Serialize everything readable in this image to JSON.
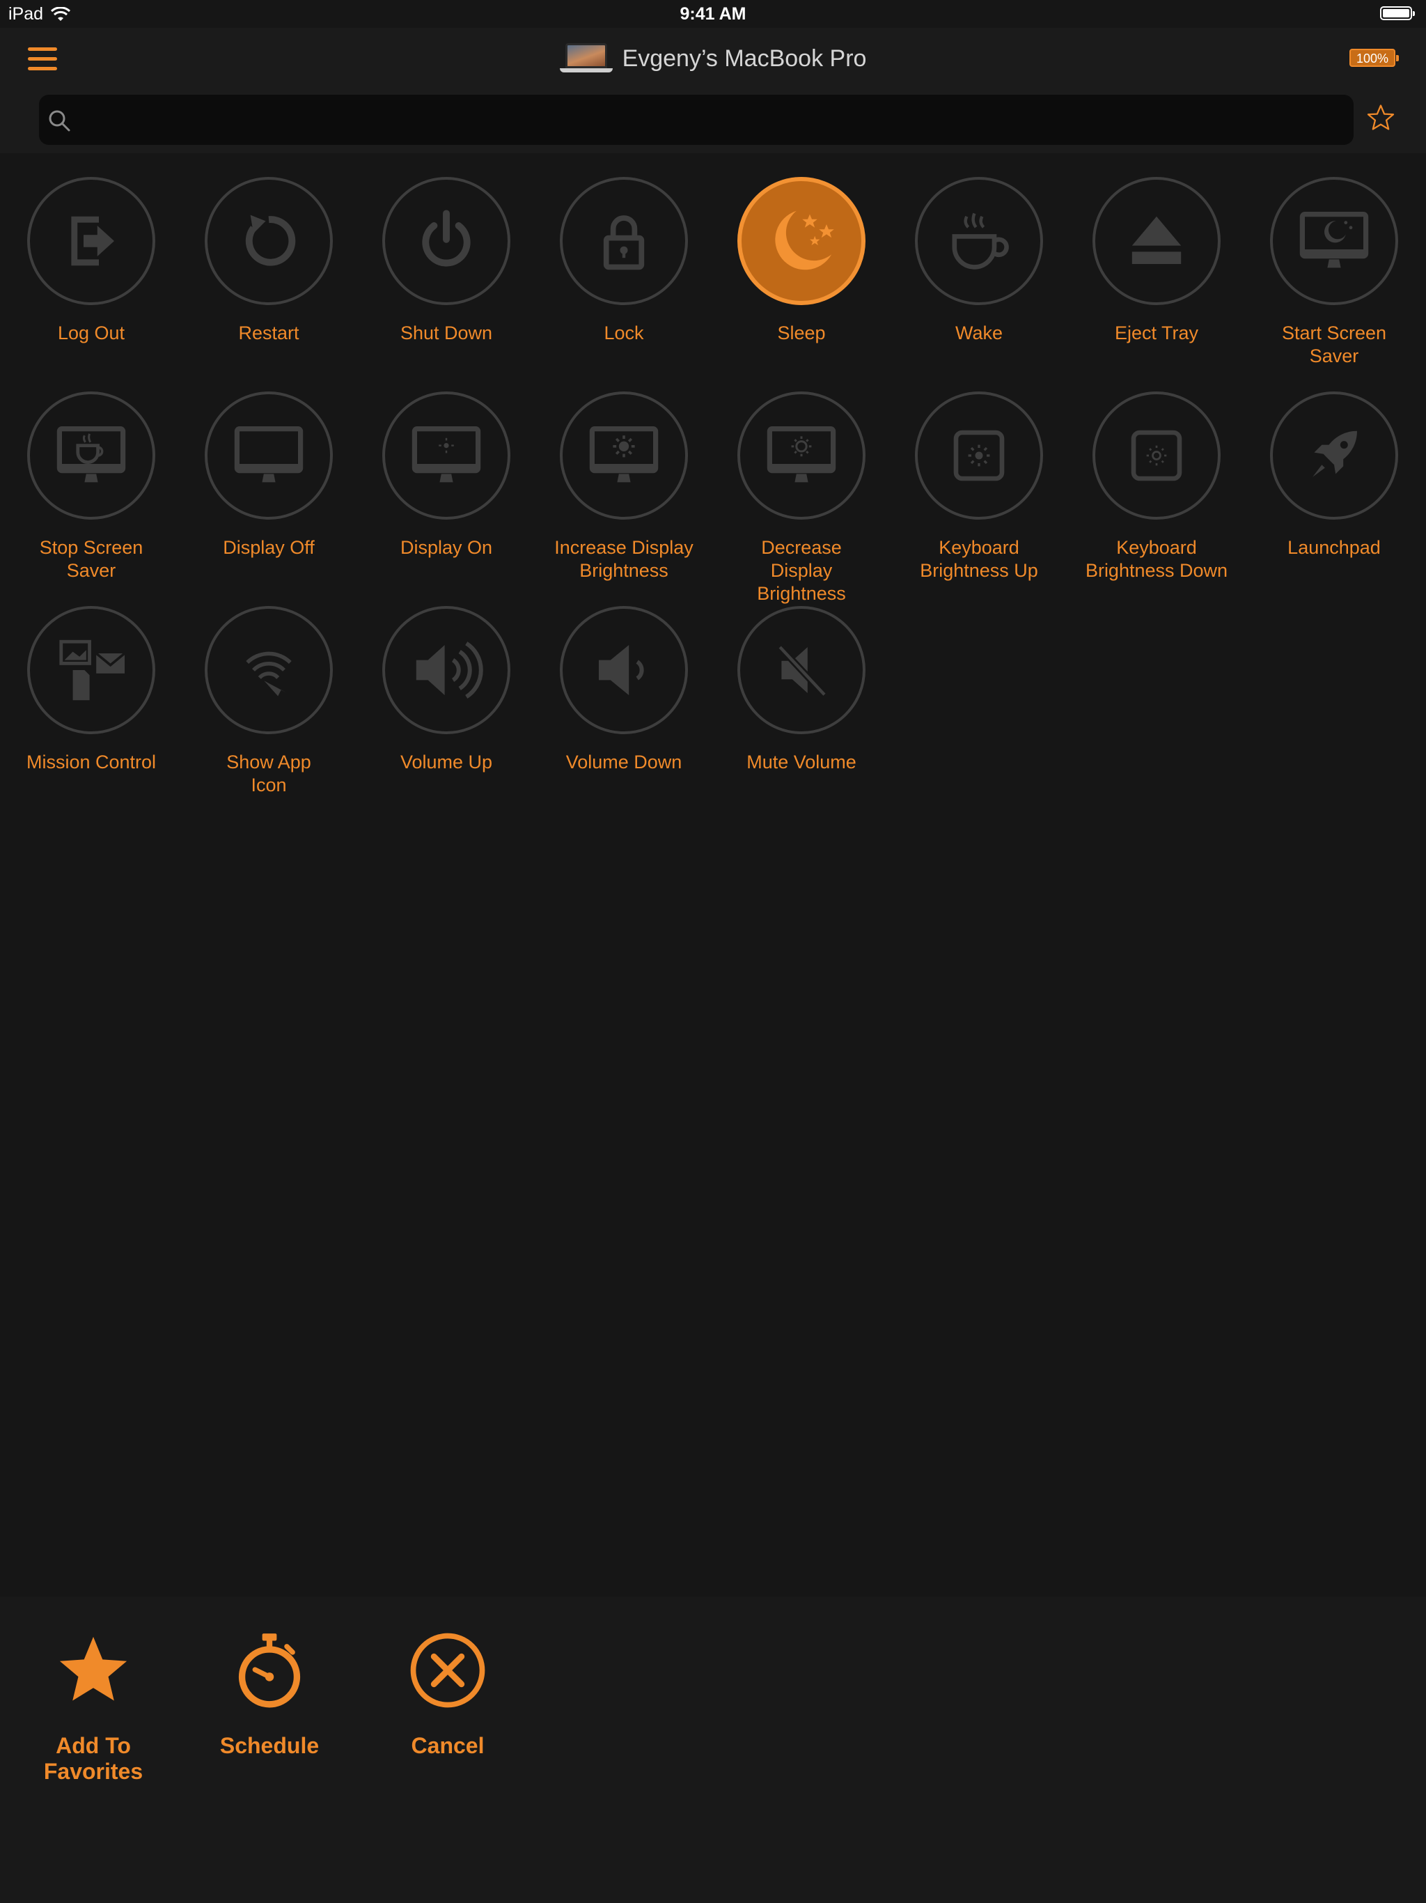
{
  "status_bar": {
    "carrier": "iPad",
    "time": "9:41 AM"
  },
  "header": {
    "device_name": "Evgeny’s MacBook Pro",
    "battery_badge": "100%"
  },
  "search": {
    "value": "",
    "placeholder": ""
  },
  "actions": [
    {
      "label": "Log Out",
      "icon": "logout-icon",
      "active": false
    },
    {
      "label": "Restart",
      "icon": "restart-icon",
      "active": false
    },
    {
      "label": "Shut Down",
      "icon": "power-icon",
      "active": false
    },
    {
      "label": "Lock",
      "icon": "lock-icon",
      "active": false
    },
    {
      "label": "Sleep",
      "icon": "moon-stars-icon",
      "active": true
    },
    {
      "label": "Wake",
      "icon": "coffee-cup-icon",
      "active": false
    },
    {
      "label": "Eject Tray",
      "icon": "eject-icon",
      "active": false
    },
    {
      "label": "Start Screen Saver",
      "icon": "monitor-moon-icon",
      "active": false
    },
    {
      "label": "Stop Screen Saver",
      "icon": "monitor-coffee-icon",
      "active": false
    },
    {
      "label": "Display Off",
      "icon": "monitor-off-icon",
      "active": false
    },
    {
      "label": "Display On",
      "icon": "monitor-on-icon",
      "active": false
    },
    {
      "label": "Increase Display Brightness",
      "icon": "monitor-brightness-up-icon",
      "active": false
    },
    {
      "label": "Decrease Display Brightness",
      "icon": "monitor-brightness-down-icon",
      "active": false
    },
    {
      "label": "Keyboard Brightness Up",
      "icon": "key-brightness-up-icon",
      "active": false
    },
    {
      "label": "Keyboard Brightness Down",
      "icon": "key-brightness-down-icon",
      "active": false
    },
    {
      "label": "Launchpad",
      "icon": "rocket-icon",
      "active": false
    },
    {
      "label": "Mission Control",
      "icon": "mission-control-icon",
      "active": false
    },
    {
      "label": "Show App Icon",
      "icon": "show-app-icon",
      "active": false
    },
    {
      "label": "Volume Up",
      "icon": "volume-up-icon",
      "active": false
    },
    {
      "label": "Volume Down",
      "icon": "volume-down-icon",
      "active": false
    },
    {
      "label": "Mute Volume",
      "icon": "volume-mute-icon",
      "active": false
    }
  ],
  "bottom_actions": {
    "add_to_favorites": "Add To Favorites",
    "schedule": "Schedule",
    "cancel": "Cancel"
  },
  "colors": {
    "accent": "#f08a2a",
    "background": "#161616",
    "icon_gray": "#3e3e3e",
    "active_fill": "#c06917"
  }
}
